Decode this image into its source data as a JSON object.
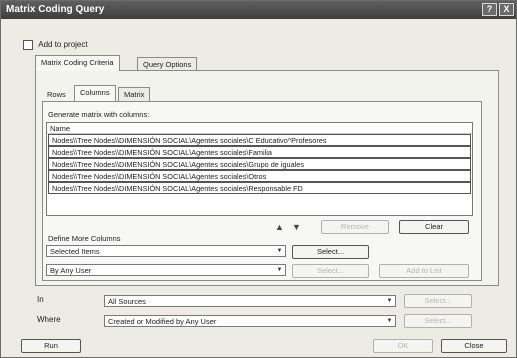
{
  "window": {
    "title": "Matrix Coding Query",
    "help": "?",
    "close": "X"
  },
  "add_to_project": {
    "label": "Add to project",
    "checked": false
  },
  "main_tabs": [
    {
      "label": "Matrix Coding Criteria",
      "active": true
    },
    {
      "label": "Query Options",
      "active": false
    }
  ],
  "sub_tabs": [
    {
      "label": "Rows",
      "active": false
    },
    {
      "label": "Columns",
      "active": true
    },
    {
      "label": "Matrix",
      "active": false
    }
  ],
  "columns_panel": {
    "caption": "Generate matrix with columns:",
    "list_header": "Name",
    "rows": [
      "Nodes\\\\Tree Nodes\\\\DIMENSIÓN SOCIAL\\Agentes sociales\\C Educativo^Profesores",
      "Nodes\\\\Tree Nodes\\\\DIMENSIÓN SOCIAL\\Agentes sociales\\Familia",
      "Nodes\\\\Tree Nodes\\\\DIMENSIÓN SOCIAL\\Agentes sociales\\Grupo de iguales",
      "Nodes\\\\Tree Nodes\\\\DIMENSIÓN SOCIAL\\Agentes sociales\\Otros",
      "Nodes\\\\Tree Nodes\\\\DIMENSIÓN SOCIAL\\Agentes sociales\\Responsable FD"
    ],
    "up_arrow": "▲",
    "down_arrow": "▼",
    "remove_label": "Remove",
    "clear_label": "Clear"
  },
  "define_more": {
    "label": "Define More Columns",
    "items_value": "Selected Items",
    "user_value": "By Any User",
    "select_label": "Select...",
    "select2_label": "Select...",
    "add_to_list_label": "Add to List"
  },
  "in_field": {
    "label": "In",
    "value": "All Sources",
    "button": "Select..."
  },
  "where_field": {
    "label": "Where",
    "value": "Created or Modified by Any User",
    "button": "Select..."
  },
  "footer": {
    "run_label": "Run",
    "ok_label": "OK",
    "close_label": "Close"
  }
}
